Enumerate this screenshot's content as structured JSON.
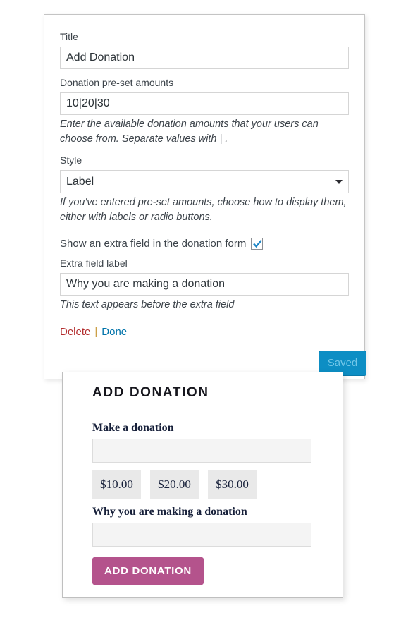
{
  "widget": {
    "title_label": "Title",
    "title_value": "Add Donation",
    "amounts_label": "Donation pre-set amounts",
    "amounts_value": "10|20|30",
    "amounts_help": "Enter the available donation amounts that your users can choose from. Separate values with | .",
    "style_label": "Style",
    "style_value": "Label",
    "style_help": "If you've entered pre-set amounts, choose how to display them, either with labels or radio buttons.",
    "extra_field_toggle_label": "Show an extra field in the donation form",
    "extra_field_checked": true,
    "extra_label_label": "Extra field label",
    "extra_label_value": "Why you are making a donation",
    "extra_label_help": "This text appears before the extra field",
    "delete_label": "Delete",
    "separator": "|",
    "done_label": "Done",
    "saved_label": "Saved"
  },
  "preview": {
    "heading": "ADD DONATION",
    "donation_label": "Make a donation",
    "donation_value": "",
    "amounts": [
      "$10.00",
      "$20.00",
      "$30.00"
    ],
    "extra_label": "Why you are making a donation",
    "extra_value": "",
    "submit_label": "ADD DONATION"
  }
}
